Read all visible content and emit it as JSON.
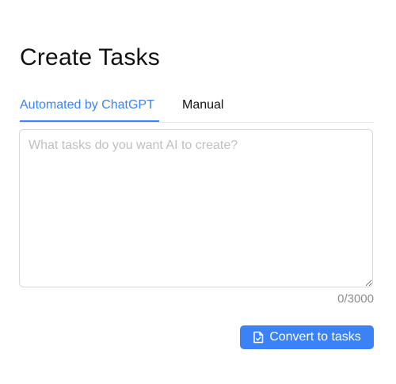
{
  "page": {
    "title": "Create Tasks"
  },
  "tabs": [
    {
      "label": "Automated by ChatGPT",
      "active": true
    },
    {
      "label": "Manual",
      "active": false
    }
  ],
  "prompt": {
    "placeholder": "What tasks do you want AI to create?",
    "value": "",
    "char_count": "0/3000"
  },
  "actions": {
    "convert_label": "Convert to tasks",
    "convert_icon": "file-check-icon"
  },
  "colors": {
    "accent": "#3b82f6",
    "placeholder": "#bfbfbf",
    "muted": "#8c8c8c"
  }
}
